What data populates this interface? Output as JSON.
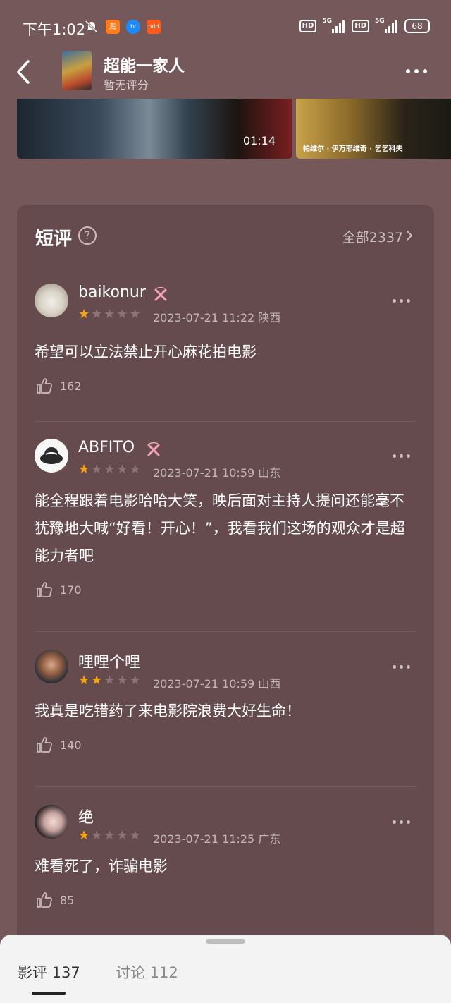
{
  "status_bar": {
    "time": "下午1:02",
    "app_icon_1": "淘",
    "app_icon_2": "tv",
    "app_icon_3": "pdd",
    "hd1": "HD",
    "net1": "5G",
    "hd2": "HD",
    "net2": "5G",
    "battery": "68"
  },
  "header": {
    "title": "超能一家人",
    "subtitle": "暂无评分"
  },
  "video": {
    "duration": "01:14",
    "caption": "帕维尔 · 伊万耶维奇 · 乞乞科夫"
  },
  "reviews_section": {
    "title": "短评",
    "all_label": "全部2337",
    "items": [
      {
        "username": "baikonur",
        "rating": 1,
        "date": "2023-07-21 11:22",
        "location": "陕西",
        "text": "希望可以立法禁止开心麻花拍电影",
        "likes": "162"
      },
      {
        "username": "ABFITO",
        "rating": 1,
        "date": "2023-07-21 10:59",
        "location": "山东",
        "text": "能全程跟着电影哈哈大笑，映后面对主持人提问还能毫不犹豫地大喊“好看！开心！”，我看我们这场的观众才是超能力者吧",
        "likes": "170"
      },
      {
        "username": "哩哩个哩",
        "rating": 2,
        "date": "2023-07-21 10:59",
        "location": "山西",
        "text": "我真是吃错药了来电影院浪费大好生命！",
        "likes": "140"
      },
      {
        "username": "绝",
        "rating": 1,
        "date": "2023-07-21 11:25",
        "location": "广东",
        "text": "难看死了，诈骗电影",
        "likes": "85"
      }
    ]
  },
  "bottom_tabs": {
    "tab1": "影评 137",
    "tab2": "讨论 112"
  },
  "colors": {
    "background": "#74585a",
    "card": "#654b4d",
    "star_on": "#f3a41a",
    "star_off": "#8a7476"
  }
}
